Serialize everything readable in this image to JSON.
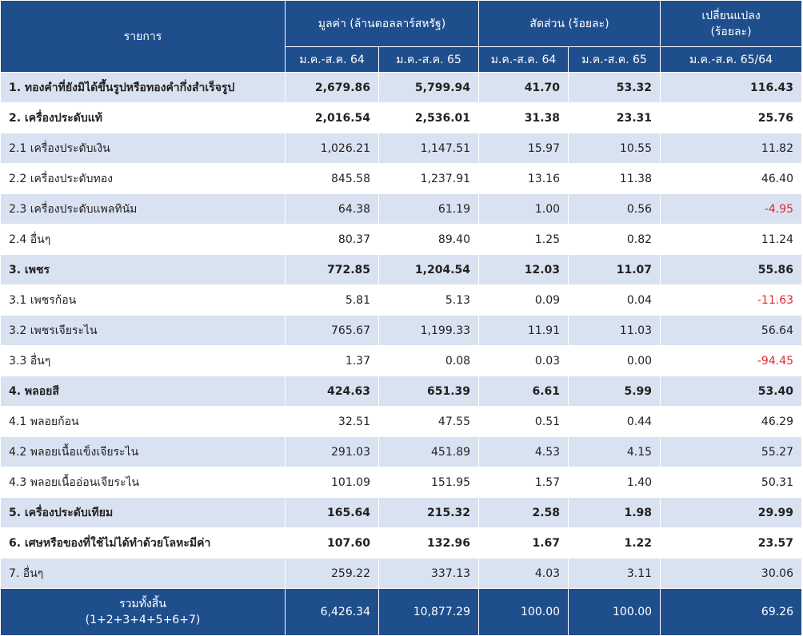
{
  "header": {
    "item": "รายการ",
    "value_group": "มูลค่า (ล้านดอลลาร์สหรัฐ)",
    "share_group": "สัดส่วน (ร้อยละ)",
    "change_line1": "เปลี่ยนแปลง",
    "change_line2": "(ร้อยละ)",
    "p64": "ม.ค.-ส.ค. 64",
    "p65": "ม.ค.-ส.ค. 65",
    "change_period": "ม.ค.-ส.ค. 65/64"
  },
  "rows": [
    {
      "name": "1. ทองคำที่ยังมิได้ขึ้นรูปหรือทองคำกึ่งสำเร็จรูป",
      "v64": "2,679.86",
      "v65": "5,799.94",
      "s64": "41.70",
      "s65": "53.32",
      "chg": "116.43"
    },
    {
      "name": "2. เครื่องประดับแท้",
      "v64": "2,016.54",
      "v65": "2,536.01",
      "s64": "31.38",
      "s65": "23.31",
      "chg": "25.76"
    },
    {
      "name": "2.1 เครื่องประดับเงิน",
      "v64": "1,026.21",
      "v65": "1,147.51",
      "s64": "15.97",
      "s65": "10.55",
      "chg": "11.82"
    },
    {
      "name": "2.2 เครื่องประดับทอง",
      "v64": "845.58",
      "v65": "1,237.91",
      "s64": "13.16",
      "s65": "11.38",
      "chg": "46.40"
    },
    {
      "name": "2.3 เครื่องประดับแพลทินัม",
      "v64": "64.38",
      "v65": "61.19",
      "s64": "1.00",
      "s65": "0.56",
      "chg": "-4.95"
    },
    {
      "name": "2.4 อื่นๆ",
      "v64": "80.37",
      "v65": "89.40",
      "s64": "1.25",
      "s65": "0.82",
      "chg": "11.24"
    },
    {
      "name": "3. เพชร",
      "v64": "772.85",
      "v65": "1,204.54",
      "s64": "12.03",
      "s65": "11.07",
      "chg": "55.86"
    },
    {
      "name": "3.1 เพชรก้อน",
      "v64": "5.81",
      "v65": "5.13",
      "s64": "0.09",
      "s65": "0.04",
      "chg": "-11.63"
    },
    {
      "name": "3.2 เพชรเจียระไน",
      "v64": "765.67",
      "v65": "1,199.33",
      "s64": "11.91",
      "s65": "11.03",
      "chg": "56.64"
    },
    {
      "name": "3.3 อื่นๆ",
      "v64": "1.37",
      "v65": "0.08",
      "s64": "0.03",
      "s65": "0.00",
      "chg": "-94.45"
    },
    {
      "name": "4. พลอยสี",
      "v64": "424.63",
      "v65": "651.39",
      "s64": "6.61",
      "s65": "5.99",
      "chg": "53.40"
    },
    {
      "name": "4.1 พลอยก้อน",
      "v64": "32.51",
      "v65": "47.55",
      "s64": "0.51",
      "s65": "0.44",
      "chg": "46.29"
    },
    {
      "name": "4.2 พลอยเนื้อแข็งเจียระไน",
      "v64": "291.03",
      "v65": "451.89",
      "s64": "4.53",
      "s65": "4.15",
      "chg": "55.27"
    },
    {
      "name": "4.3 พลอยเนื้ออ่อนเจียระไน",
      "v64": "101.09",
      "v65": "151.95",
      "s64": "1.57",
      "s65": "1.40",
      "chg": "50.31"
    },
    {
      "name": "5. เครื่องประดับเทียม",
      "v64": "165.64",
      "v65": "215.32",
      "s64": "2.58",
      "s65": "1.98",
      "chg": "29.99"
    },
    {
      "name": "6. เศษหรือของที่ใช้ไม่ได้ทำด้วยโลหะมีค่า",
      "v64": "107.60",
      "v65": "132.96",
      "s64": "1.67",
      "s65": "1.22",
      "chg": "23.57"
    },
    {
      "name": "7. อื่นๆ",
      "v64": "259.22",
      "v65": "337.13",
      "s64": "4.03",
      "s65": "3.11",
      "chg": "30.06"
    }
  ],
  "total": {
    "label_line1": "รวมทั้งสิ้น",
    "label_line2": "(1+2+3+4+5+6+7)",
    "v64": "6,426.34",
    "v65": "10,877.29",
    "s64": "100.00",
    "s65": "100.00",
    "chg": "69.26"
  },
  "colors": {
    "header_bg": "#1f4e8c",
    "band_row": "#d9e2f1",
    "negative_text": "#e8282f"
  }
}
